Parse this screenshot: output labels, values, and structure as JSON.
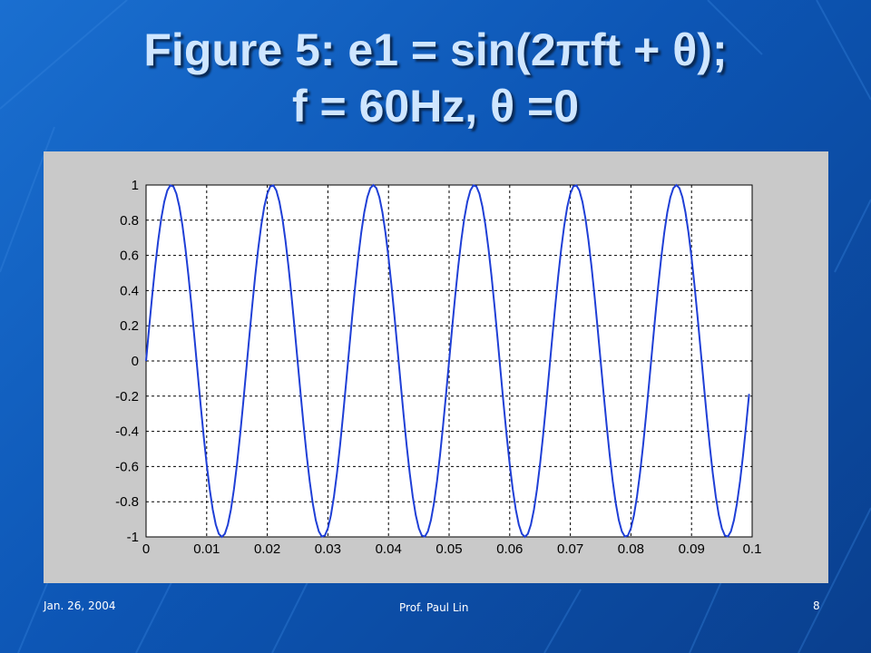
{
  "slide": {
    "title_line1": "Figure 5: e1 = sin(2πft + θ);",
    "title_line2": "f = 60Hz, θ =0",
    "footer_date": "Jan. 26, 2004",
    "footer_author": "Prof. Paul Lin",
    "page_number": "8"
  },
  "colors": {
    "background": "#1466c8",
    "title_text": "#cfe6ff",
    "plot_line": "#1f3fd6",
    "panel": "#c9c9c9"
  },
  "chart_data": {
    "type": "line",
    "title": "",
    "xlabel": "",
    "ylabel": "",
    "function": "sin(2*pi*60*t)",
    "frequency_hz": 60,
    "phase": 0,
    "x_sample_step": 0.0005,
    "xlim": [
      0,
      0.1
    ],
    "ylim": [
      -1,
      1
    ],
    "x_ticks": [
      0,
      0.01,
      0.02,
      0.03,
      0.04,
      0.05,
      0.06,
      0.07,
      0.08,
      0.09,
      0.1
    ],
    "x_tick_labels": [
      "0",
      "0.01",
      "0.02",
      "0.03",
      "0.04",
      "0.05",
      "0.06",
      "0.07",
      "0.08",
      "0.09",
      "0.1"
    ],
    "y_ticks": [
      -1,
      -0.8,
      -0.6,
      -0.4,
      -0.2,
      0,
      0.2,
      0.4,
      0.6,
      0.8,
      1
    ],
    "y_tick_labels": [
      "-1",
      "-0.8",
      "-0.6",
      "-0.4",
      "-0.2",
      "0",
      "0.2",
      "0.4",
      "0.6",
      "0.8",
      "1"
    ],
    "x_range_plotted": [
      0,
      0.0995
    ],
    "grid": true,
    "series": [
      {
        "color": "#1f3fd6"
      }
    ]
  }
}
